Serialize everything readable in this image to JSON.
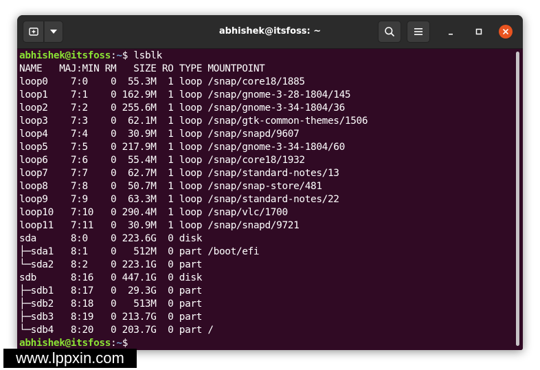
{
  "window": {
    "title": "abhishek@itsfoss: ~"
  },
  "titlebar": {
    "icons": [
      "new-tab-icon",
      "chevron-down-icon",
      "search-icon",
      "hamburger-menu-icon",
      "minimize-icon",
      "maximize-icon",
      "close-icon"
    ]
  },
  "colors": {
    "terminal_bg": "#300a24",
    "prompt_user": "#8ae234",
    "prompt_path": "#729fcf",
    "close_button": "#e95420"
  },
  "prompt": {
    "userhost": "abhishek@itsfoss",
    "colon": ":",
    "path": "~",
    "symbol": "$"
  },
  "command": "lsblk",
  "output": [
    "NAME   MAJ:MIN RM   SIZE RO TYPE MOUNTPOINT",
    "loop0    7:0    0  55.3M  1 loop /snap/core18/1885",
    "loop1    7:1    0 162.9M  1 loop /snap/gnome-3-28-1804/145",
    "loop2    7:2    0 255.6M  1 loop /snap/gnome-3-34-1804/36",
    "loop3    7:3    0  62.1M  1 loop /snap/gtk-common-themes/1506",
    "loop4    7:4    0  30.9M  1 loop /snap/snapd/9607",
    "loop5    7:5    0 217.9M  1 loop /snap/gnome-3-34-1804/60",
    "loop6    7:6    0  55.4M  1 loop /snap/core18/1932",
    "loop7    7:7    0  62.7M  1 loop /snap/standard-notes/13",
    "loop8    7:8    0  50.7M  1 loop /snap/snap-store/481",
    "loop9    7:9    0  63.3M  1 loop /snap/standard-notes/22",
    "loop10   7:10   0 290.4M  1 loop /snap/vlc/1700",
    "loop11   7:11   0  30.9M  1 loop /snap/snapd/9721",
    "sda      8:0    0 223.6G  0 disk ",
    "├─sda1   8:1    0   512M  0 part /boot/efi",
    "└─sda2   8:2    0 223.1G  0 part ",
    "sdb      8:16   0 447.1G  0 disk ",
    "├─sdb1   8:17   0  29.3G  0 part ",
    "├─sdb2   8:18   0   513M  0 part ",
    "├─sdb3   8:19   0 213.7G  0 part ",
    "└─sdb4   8:20   0 203.7G  0 part /"
  ],
  "watermark": "www.lppxin.com"
}
